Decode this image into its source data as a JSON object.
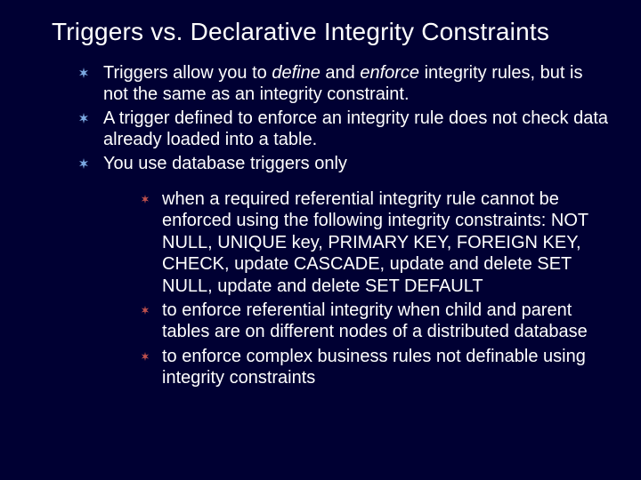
{
  "title": "Triggers vs. Declarative Integrity Constraints",
  "bullets": [
    {
      "pre": "Triggers allow you to ",
      "i1": "define",
      "mid": " and ",
      "i2": "enforce",
      "post": " integrity rules, but is not the same as an integrity constraint."
    },
    {
      "text": "A trigger defined to enforce an integrity rule does not check data already loaded into a table."
    },
    {
      "text": "You use database triggers only"
    }
  ],
  "sub_bullets": [
    {
      "text": "when a required referential integrity rule cannot be enforced using the following integrity constraints: NOT NULL, UNIQUE key, PRIMARY KEY, FOREIGN KEY, CHECK, update CASCADE, update and delete SET NULL, update and delete SET  DEFAULT"
    },
    {
      "text": " to enforce referential integrity when child and parent tables are on different nodes of a distributed database"
    },
    {
      "text": " to enforce complex business rules not definable using integrity constraints"
    }
  ],
  "colors": {
    "background": "#000033",
    "text": "#ffffff",
    "bullet_main": "#7aa7e0",
    "bullet_sub": "#c0504d"
  }
}
